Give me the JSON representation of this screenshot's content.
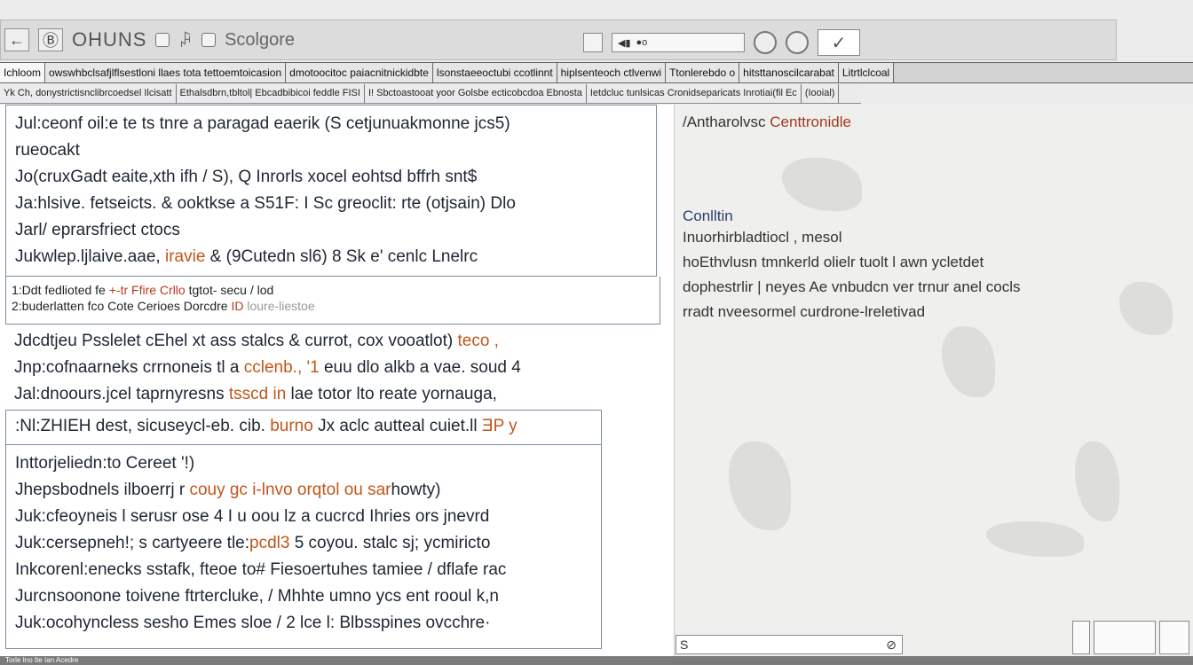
{
  "toolbar": {
    "back_label": "←",
    "doc_icon_label": "Ⓑ",
    "title": "OHUNS",
    "print_label": "ꇮ",
    "search_text": "Scolgore",
    "zoom_label": "◎",
    "check_label": "✓"
  },
  "tabs_row1": [
    "Ichloom",
    "owswhbclsafjlflsestloni llaes tota tettoemtoicasion",
    "dmotoocitoc paiacnitnickidbte",
    "lsonstaeeoctubi ccotlinnt",
    "hiplsenteoch ctlvenwi",
    "Ttonlerebdo o",
    "hitsttanoscilcarabat",
    "Litrtlclcoal"
  ],
  "tabs_row2": [
    "Yk Ch, donystrictisnclibrcoedsel Ilcisatt",
    "Ethalsdbrn,tbltol| Ebcadbibicoi feddle FISI",
    "I! Sbctoastooat yoor Golsbe ecticobcdoa Ebnosta",
    "Ietdcluc tunlsicas Cronidseparicats Inrotiai(fil Ec",
    "(Iooial)"
  ],
  "doc": {
    "para1": [
      {
        "text": "Jul:ceonf oil:e te ts tnre a paragad eaerik (S cetjunuakmonne jcs5)"
      },
      {
        "text": "rueocakt"
      },
      {
        "text": "Jo(cruxGadt eaite,xth ifh / S), Q Inrorls xocel eohtsd bffrh snt$"
      },
      {
        "text": "Ja:hlsive. fetseicts. & ooktkse a S51F: I Sc greoclit: rte (otjsain) Dlo"
      },
      {
        "text": "Jarl/ eprarsfriect ctocs"
      },
      {
        "pre": "Jukwlep.ljlaive.aae, ",
        "hl": "iravie",
        "post": " & (9Cutedn sl6) 8 Sk e' cenlc Lnelrc"
      }
    ],
    "caption1": {
      "pre": "1:Ddt fedlioted fe ",
      "red": "+-tr Ffire Crllo",
      "post": " tgtot- secu / lod"
    },
    "caption2": {
      "pre": "2:buderlatten fco Cote Cerioes Dorcdre ",
      "red": "ID",
      "muted": " loure-liestoe"
    },
    "para2": [
      {
        "pre": "Jdcdtjeu Psslelet cEhel xt ass stalcs & currot, cox vooatlot) ",
        "hl": "teco ,",
        "post": ""
      },
      {
        "pre": "Jnp:cofnaarneks crrnoneis tl a ",
        "hl": "cclenb., '1",
        "post": " euu dlo alkb a vae. soud 4"
      },
      {
        "pre": "Jal:dnoours.jcel taprnyresns ",
        "hl": "tsscd in ",
        "post": "lae totor lto reate yornauga,"
      }
    ],
    "notebox": {
      "pre": ":Nl:ZHIEH dest, sicuseycl-eb. cib. ",
      "hl": "burno",
      "post": " Jx aclc autteal cuiet.ll",
      "tail": " ƎP y"
    },
    "para3_heading": "Inttorjeliedn:to Cereet '!)",
    "para3": [
      {
        "pre": "Jhepsbodnels ilboerrj r ",
        "hl": "couy gc i-lnvo orqtol ou sar",
        "post": "howty) "
      },
      {
        "pre": "Juk:cfeoyneis l serusr ose 4 I u oou lz a cucrcd Ihries ors jnevrd",
        "hl": "",
        "post": ""
      },
      {
        "pre": "Juk:cersepneh!; s cartyeere tle:",
        "hl": "pcdl3",
        "post": " 5 coyou. stalc sj; ycmiricto"
      },
      {
        "pre": "Inkcorenl:enecks sstafk, fteoe to# Fiesoertuhes tamiee / dflafe rac",
        "hl": "",
        "post": ""
      },
      {
        "pre": "Jurcnsoonone toivene ftrtercluke,  /   Mhhte umno ycs ent rooul k,n",
        "hl": "",
        "post": ""
      },
      {
        "pre": "Juk:ocohyncless sesho Emes sloe / 2 lce l: Blbsspines ovcchre·",
        "hl": "",
        "post": ""
      }
    ]
  },
  "right": {
    "title_pre": "/Antharolvsc ",
    "title_red": "Centtronidle",
    "heading": "Conlltin",
    "lines": [
      "Inuorhirbladtiocl , mesol",
      "hoEthvlusn tmnkerld olielr  tuolt l awn ycletdet",
      "dophestrlir  | neyes Ae vnbudcn ver trnur anel cocls",
      "rradt nveesormel  curdrone-lreletivad"
    ],
    "input_text": "S",
    "input_icon": "⊘"
  },
  "status": {
    "text": "Torle Ino Ite Ian Acedre"
  }
}
